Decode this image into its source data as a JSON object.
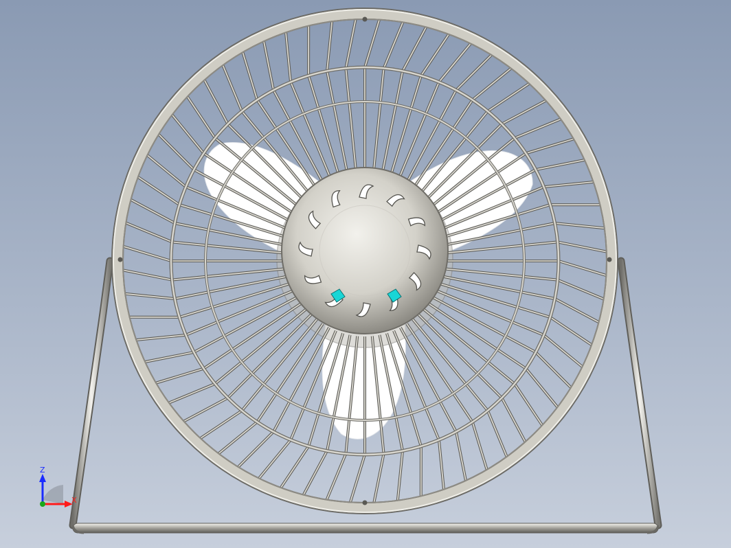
{
  "viewport": {
    "background_top": "#8a9ab3",
    "background_bottom": "#c7cfdc"
  },
  "model": {
    "kind": "desk-fan",
    "guard_color": "#c9c7be",
    "guard_wire_count": 64,
    "blade_count": 3,
    "blade_color": "#ffffff",
    "hub_color": "#d8d6cf",
    "hub_vent_count": 12,
    "accent_color": "#19d6d6"
  },
  "triad": {
    "z_label": "Z",
    "x_label": "X",
    "z_color": "#1a2cff",
    "x_color": "#ff1a1a",
    "y_color": "#1aa81a"
  }
}
